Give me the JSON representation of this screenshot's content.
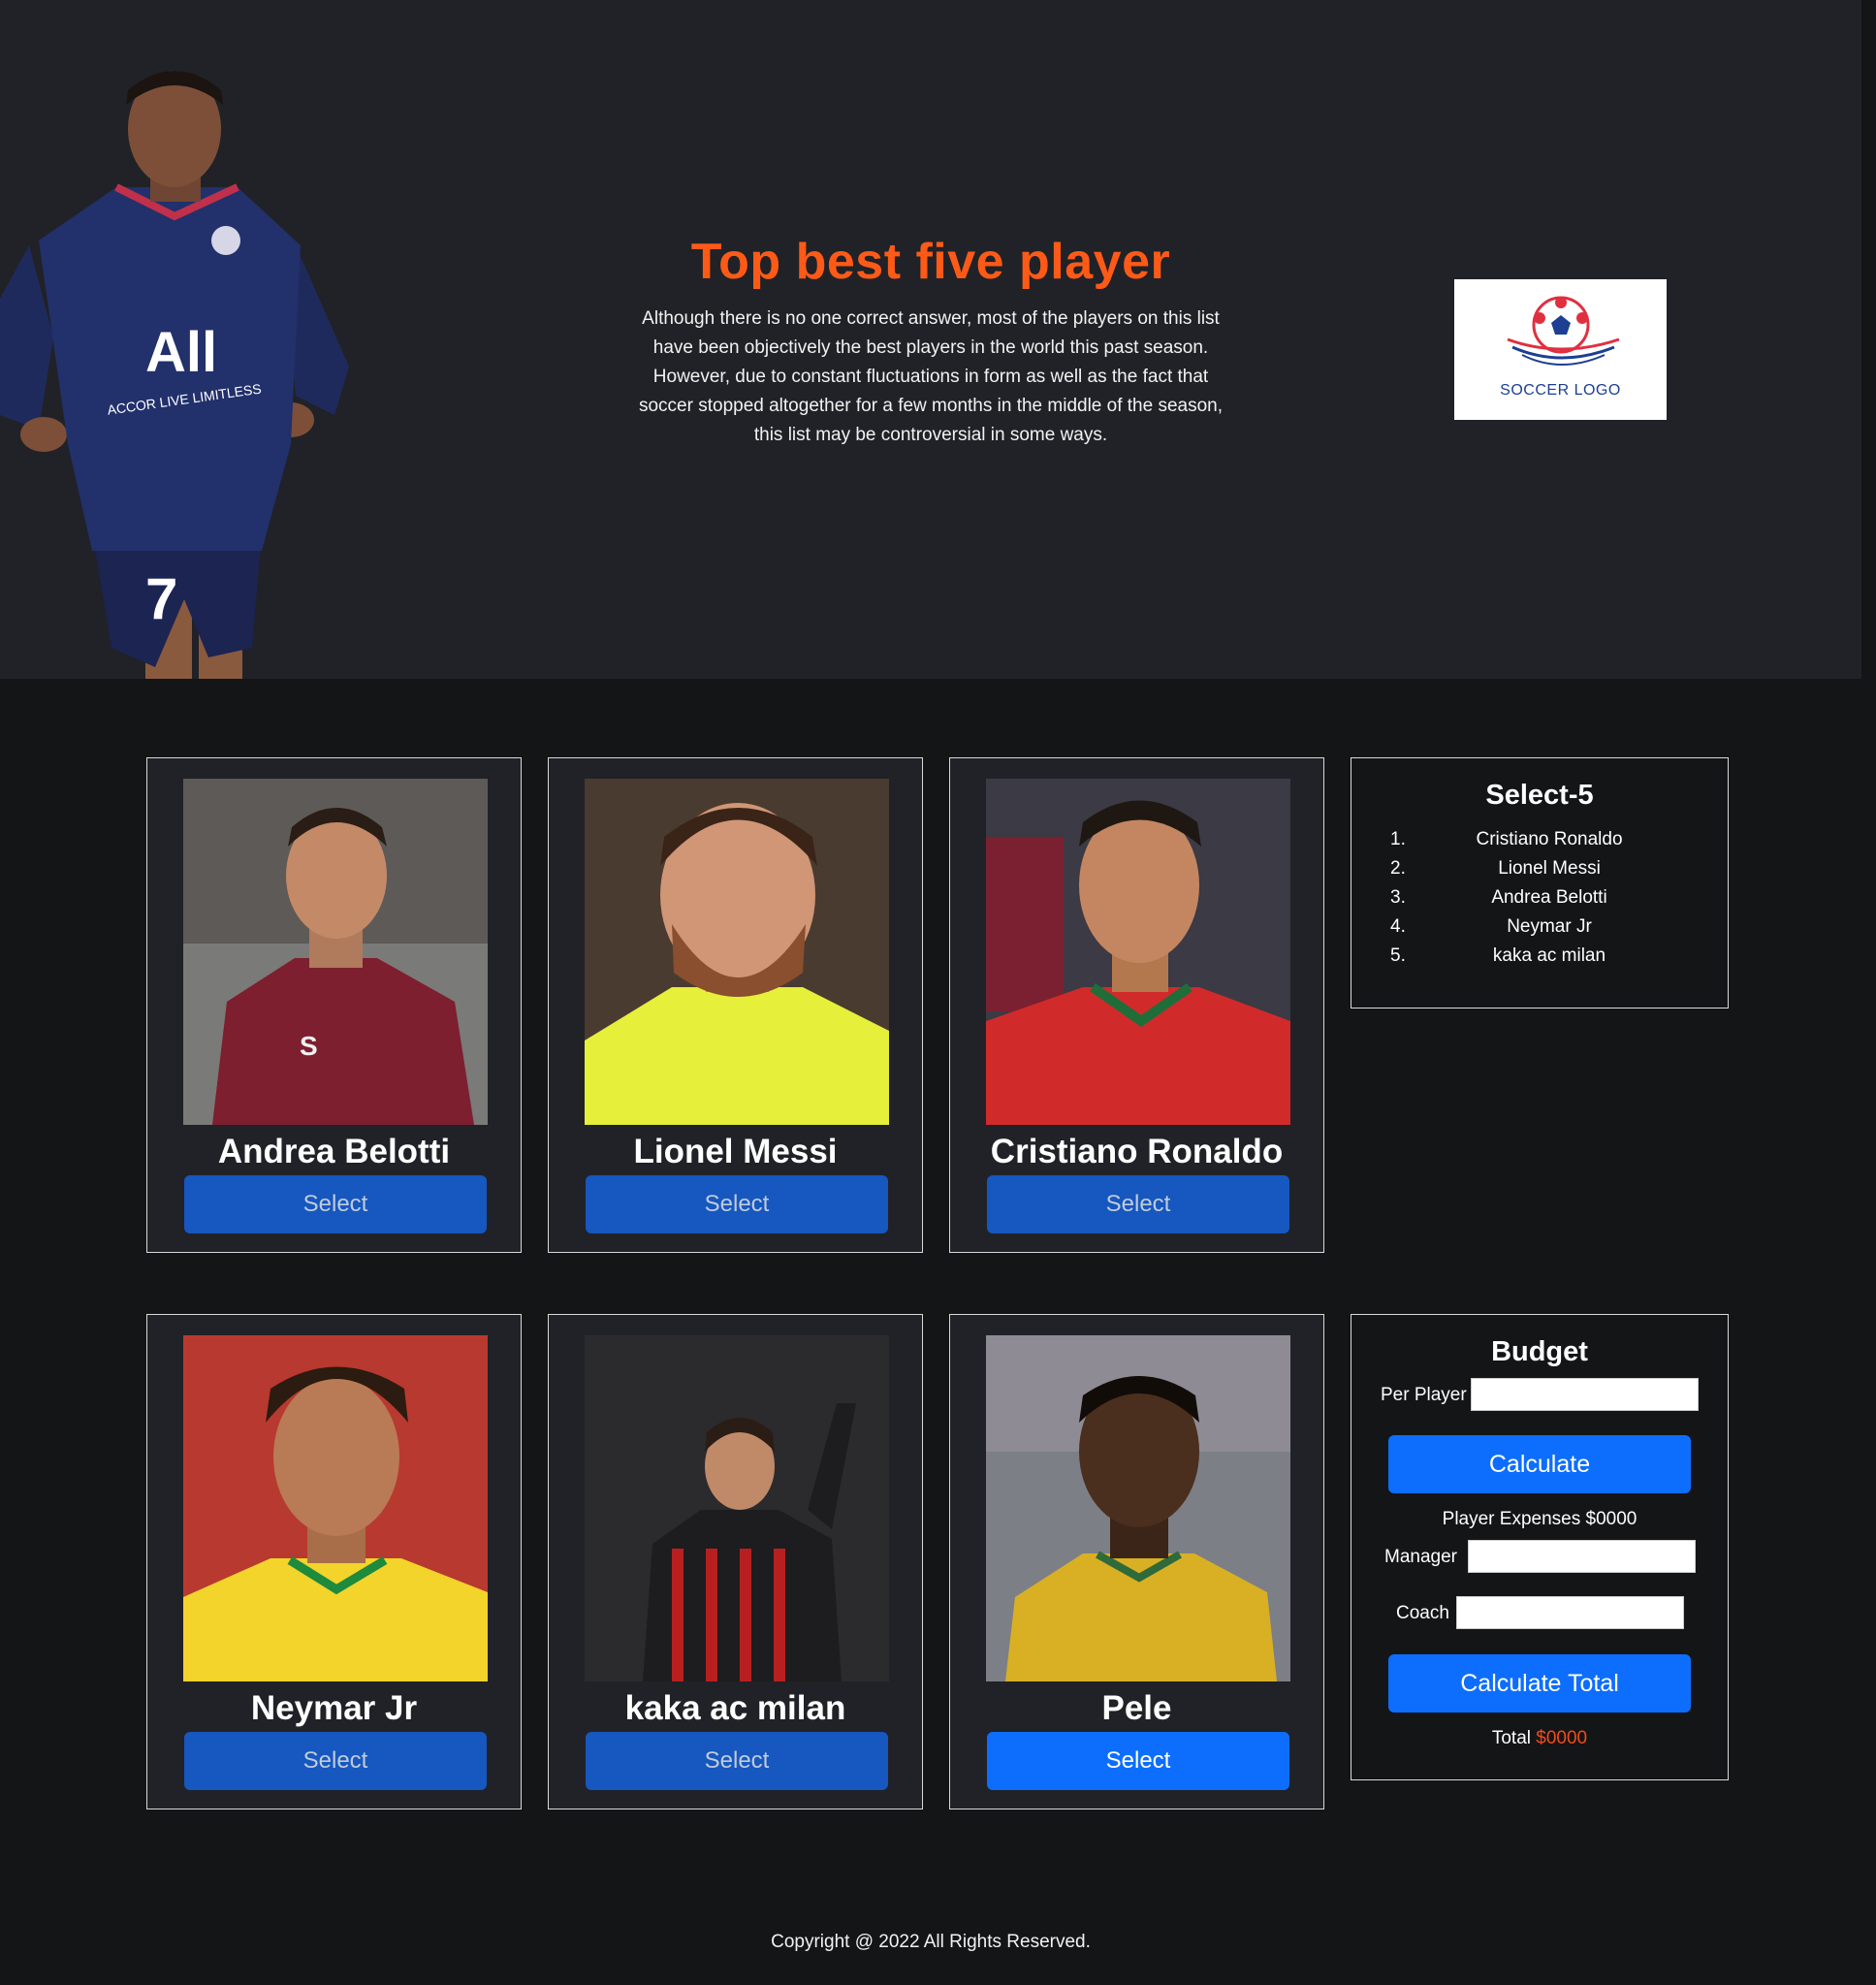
{
  "hero": {
    "title": "Top best five player",
    "description": "Although there is no one correct answer, most of the players on this list have been objectively the best players in the world this past season. However, due to constant fluctuations in form as well as the fact that soccer stopped altogether for a few months in the middle of the season, this list may be controversial in some ways.",
    "logo_text": "SOCCER LOGO"
  },
  "players": [
    {
      "name": "Andrea Belotti",
      "select_label": "Select"
    },
    {
      "name": "Lionel Messi",
      "select_label": "Select"
    },
    {
      "name": "Cristiano Ronaldo",
      "select_label": "Select"
    },
    {
      "name": "Neymar Jr",
      "select_label": "Select"
    },
    {
      "name": "kaka ac milan",
      "select_label": "Select"
    },
    {
      "name": "Pele",
      "select_label": "Select"
    }
  ],
  "selection": {
    "title": "Select-5",
    "items": [
      {
        "num": "1.",
        "name": "Cristiano Ronaldo"
      },
      {
        "num": "2.",
        "name": "Lionel Messi"
      },
      {
        "num": "3.",
        "name": "Andrea Belotti"
      },
      {
        "num": "4.",
        "name": "Neymar Jr"
      },
      {
        "num": "5.",
        "name": "kaka ac milan"
      }
    ]
  },
  "budget": {
    "title": "Budget",
    "per_player_label": "Per Player",
    "per_player_value": "",
    "calculate_label": "Calculate",
    "player_expenses_label": "Player Expenses",
    "player_expenses_value": "$0000",
    "manager_label": "Manager",
    "manager_value": "",
    "coach_label": "Coach",
    "coach_value": "",
    "calculate_total_label": "Calculate Total",
    "total_label": "Total",
    "total_value": "$0000"
  },
  "footer": {
    "text": "Copyright @ 2022 All Rights Reserved."
  },
  "colors": {
    "accent_orange": "#fd5a17",
    "button_blue": "#0d6efd",
    "button_blue_dim": "#1657c0",
    "header_bg": "#202227",
    "page_bg": "#141517"
  }
}
